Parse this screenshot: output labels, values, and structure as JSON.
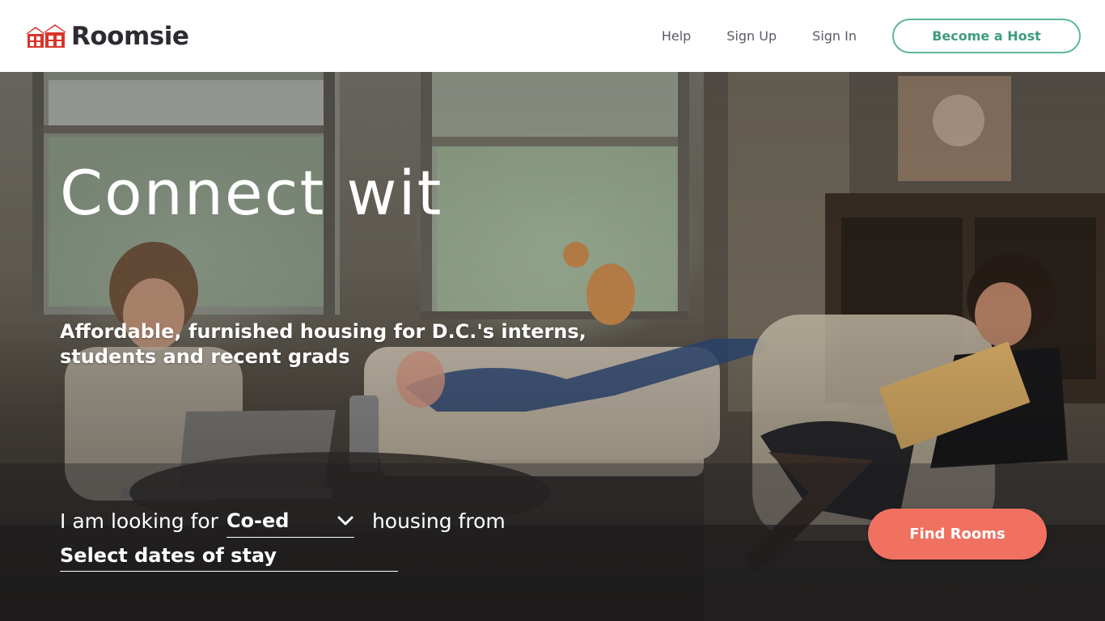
{
  "brand": {
    "name": "Roomsie",
    "logo_icon": "houses-logo-icon",
    "logo_color": "#d9342b"
  },
  "nav": {
    "help": "Help",
    "sign_up": "Sign Up",
    "sign_in": "Sign In",
    "become_host": "Become a Host",
    "host_button_color": "#5fb79a"
  },
  "hero": {
    "headline": "Connect wit",
    "subheadline": "Affordable, furnished housing for D.C.'s interns, students and recent grads",
    "background_icon": "living-room-photo"
  },
  "search": {
    "prefix": "I am looking for",
    "housing_type": "Co-ed",
    "middle": "housing from",
    "dates_placeholder": "Select dates of stay",
    "submit_label": "Find Rooms",
    "submit_color": "#f07160",
    "dropdown_icon": "chevron-down-icon"
  }
}
